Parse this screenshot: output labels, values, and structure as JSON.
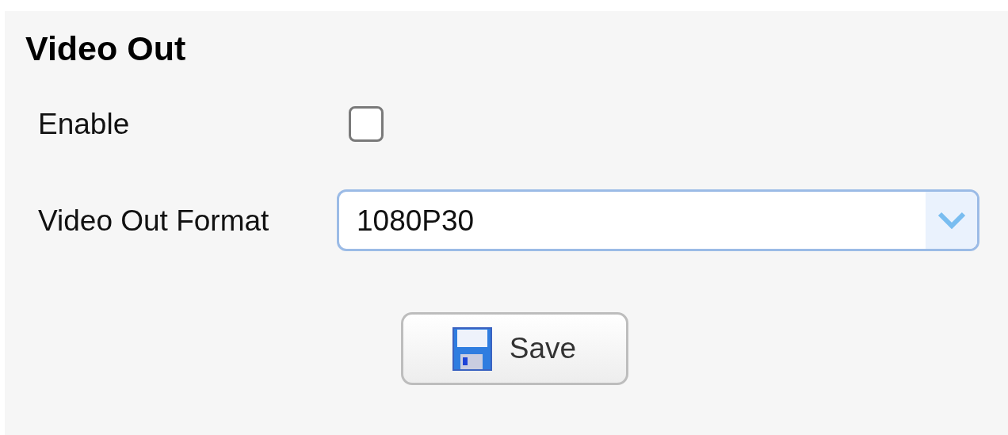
{
  "section": {
    "title": "Video Out"
  },
  "enable": {
    "label": "Enable",
    "checked": false
  },
  "format": {
    "label": "Video Out Format",
    "value": "1080P30"
  },
  "save_button": {
    "label": "Save"
  }
}
